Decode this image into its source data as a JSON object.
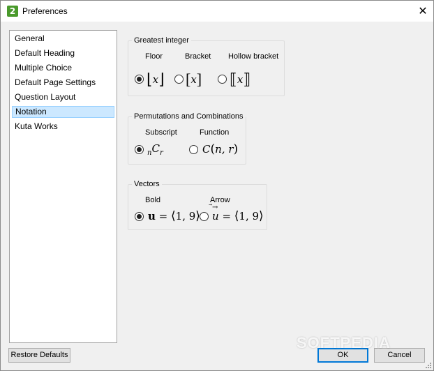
{
  "window": {
    "title": "Preferences",
    "app_icon_glyph": "2",
    "close_glyph": "✕"
  },
  "sidebar": {
    "items": [
      {
        "label": "General"
      },
      {
        "label": "Default Heading"
      },
      {
        "label": "Multiple Choice"
      },
      {
        "label": "Default Page Settings"
      },
      {
        "label": "Question Layout"
      },
      {
        "label": "Notation",
        "selected": true
      },
      {
        "label": "Kuta Works"
      }
    ]
  },
  "greatest_integer": {
    "legend": "Greatest integer",
    "options": [
      {
        "label": "Floor",
        "symbol": "x",
        "checked": true
      },
      {
        "label": "Bracket",
        "symbol": "x",
        "checked": false
      },
      {
        "label": "Hollow bracket",
        "symbol": "x",
        "checked": false
      }
    ]
  },
  "permutations": {
    "legend": "Permutations and Combinations",
    "options": [
      {
        "label": "Subscript",
        "checked": true,
        "sub_pre": "n",
        "main": "C",
        "sub_post": "r"
      },
      {
        "label": "Function",
        "checked": false,
        "main": "C",
        "args": "n, r"
      }
    ]
  },
  "vectors": {
    "legend": "Vectors",
    "options": [
      {
        "label": "Bold",
        "checked": true,
        "symbol": "u",
        "value": "1, 9"
      },
      {
        "label": "Arrow",
        "checked": false,
        "symbol": "u",
        "value": "1, 9"
      }
    ]
  },
  "buttons": {
    "restore": "Restore Defaults",
    "ok": "OK",
    "cancel": "Cancel"
  },
  "watermark": "SOFTPEDIA"
}
